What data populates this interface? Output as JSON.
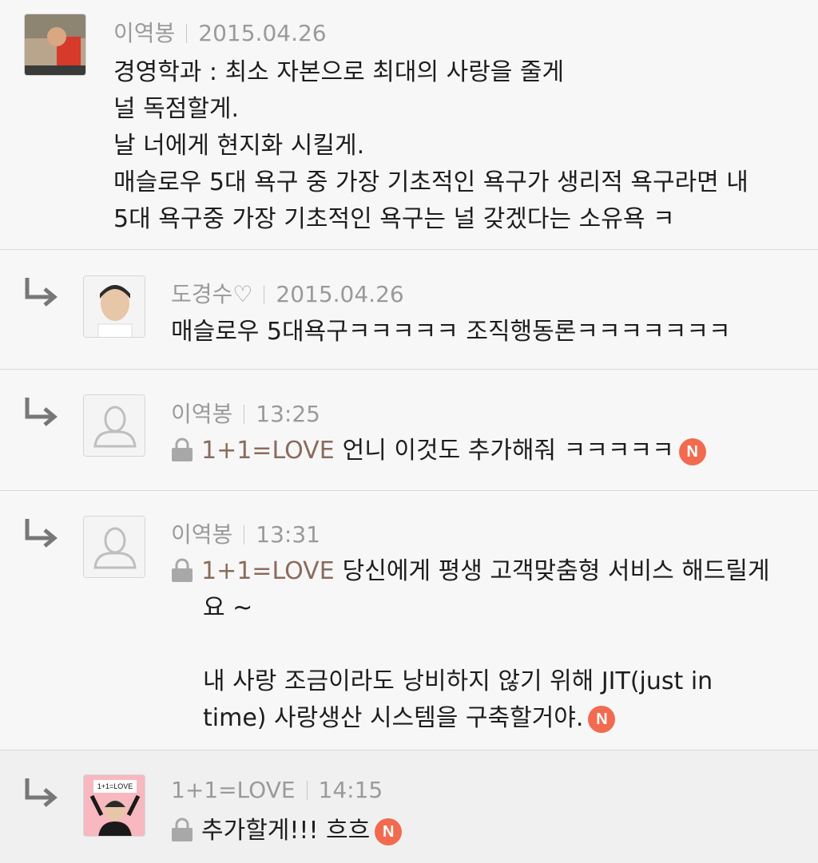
{
  "comments": [
    {
      "author": "이역봉",
      "date": "2015.04.26",
      "lines": [
        "경영학과 : 최소 자본으로 최대의 사랑을 줄게",
        "널 독점할게.",
        "날 너에게 현지화 시킬게.",
        "매슬로우 5대 욕구 중 가장 기초적인 욕구가 생리적 욕구라면 내",
        "5대 욕구중 가장 기초적인 욕구는 널 갖겠다는 소유욕 ㅋ"
      ]
    },
    {
      "author": "도경수♡",
      "date": "2015.04.26",
      "text": "매슬로우 5대욕구ㅋㅋㅋㅋㅋ 조직행동론ㅋㅋㅋㅋㅋㅋㅋ"
    },
    {
      "author": "이역봉",
      "date": "13:25",
      "mention": "1+1=LOVE",
      "text": "언니 이것도 추가해줘 ㅋㅋㅋㅋㅋ",
      "badge": "N"
    },
    {
      "author": "이역봉",
      "date": "13:31",
      "mention": "1+1=LOVE",
      "line1": "당신에게 평생 고객맞춤형 서비스 해드릴게",
      "line2": "요 ~",
      "line3": "내 사랑 조금이라도 낭비하지 않기 위해  JIT(just in",
      "line4": "time) 사랑생산 시스템을 구축할거야.",
      "badge": "N"
    },
    {
      "author": "1+1=LOVE",
      "date": "14:15",
      "avatar_caption": "1+1=LOVE",
      "text": "추가할게!!! 흐흐",
      "badge": "N"
    }
  ],
  "icons": {
    "reply_arrow": "reply-arrow-icon",
    "lock": "lock-icon",
    "default_avatar": "default-avatar-icon",
    "new_badge": "new-badge-icon"
  },
  "colors": {
    "background": "#f7f7f7",
    "mention": "#8a6b5c",
    "badge": "#f26a4f",
    "meta": "#9a9a9a"
  }
}
